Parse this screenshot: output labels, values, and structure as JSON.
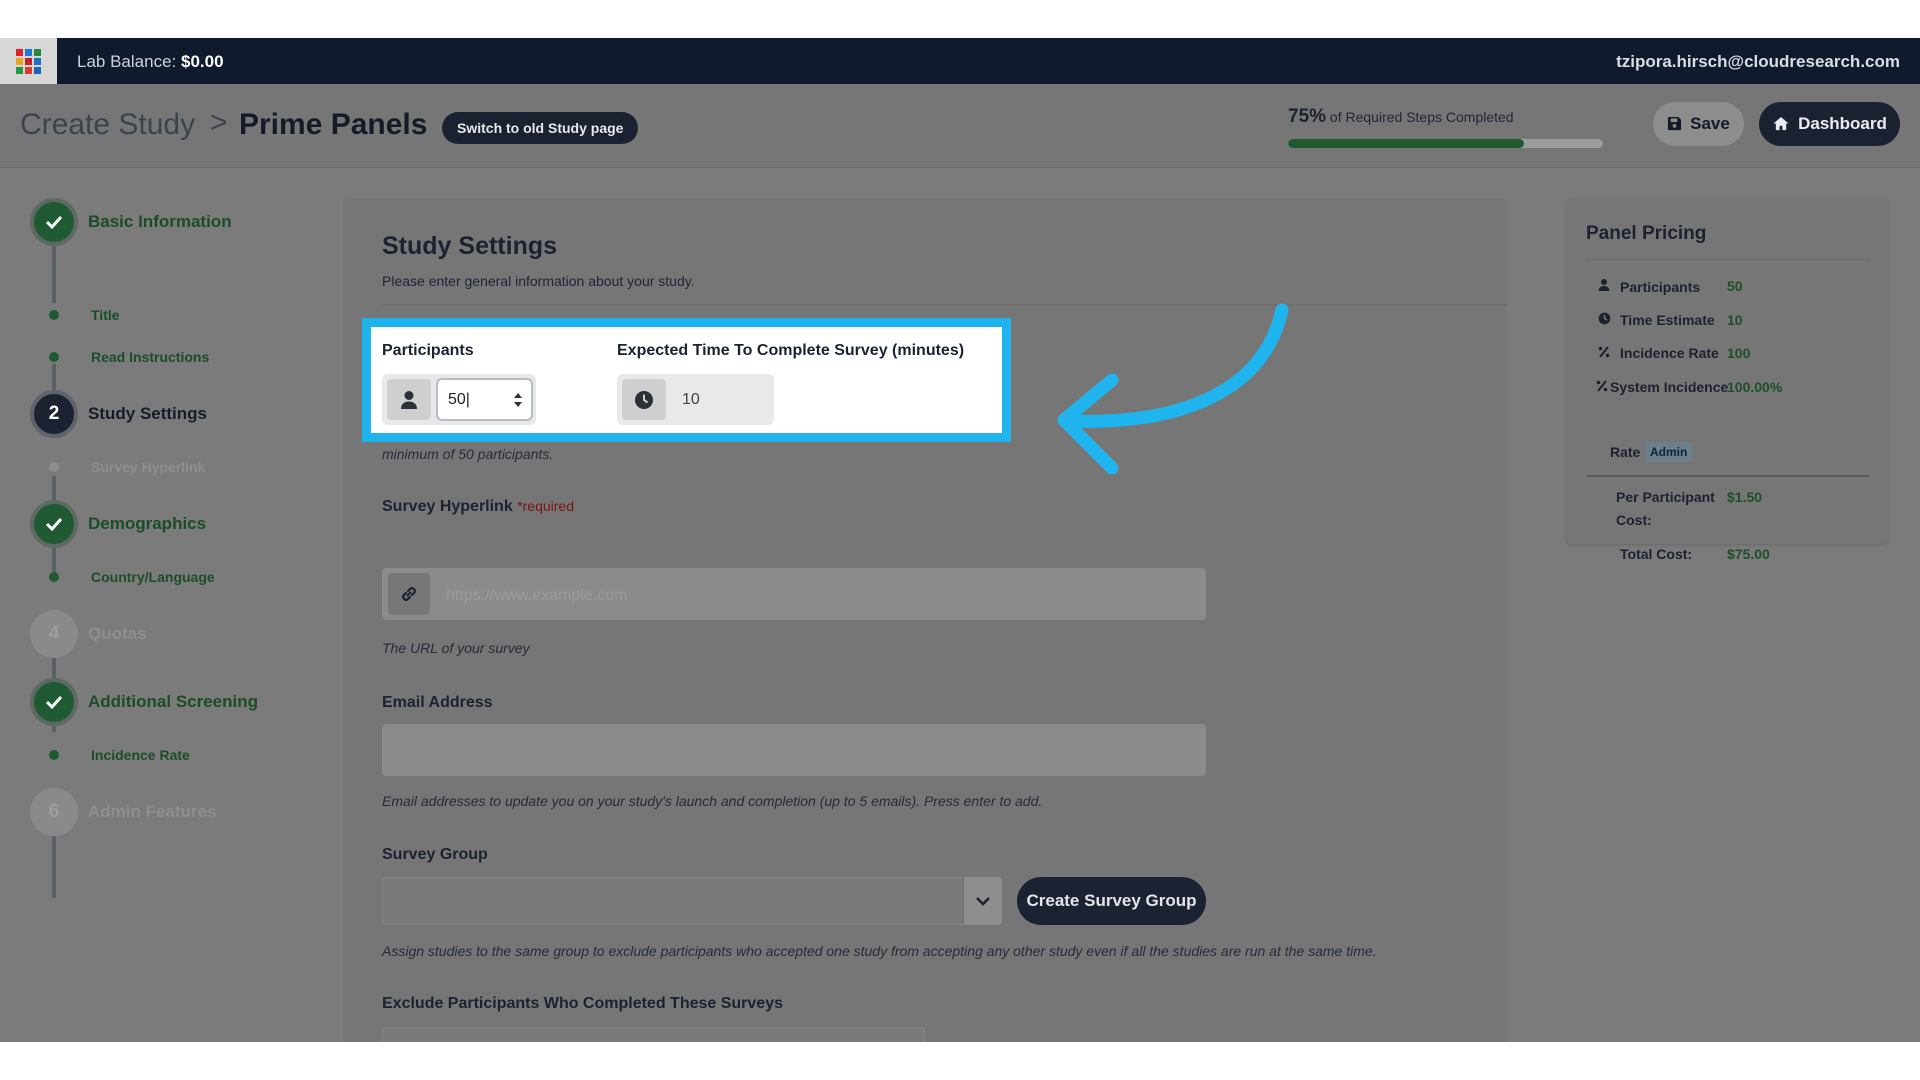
{
  "topbar": {
    "lab_balance_label": "Lab Balance:",
    "lab_balance_value": "$0.00",
    "user_email": "tzipora.hirsch@cloudresearch.com",
    "apps_colors": [
      "#e0202a",
      "#1f7bd6",
      "#2a8a3a",
      "#e8a320",
      "#c02428",
      "#1b6fc4",
      "#239a3f",
      "#d83a2c",
      "#1e64b6"
    ]
  },
  "header": {
    "crumb_parent": "Create Study",
    "crumb_separator": ">",
    "crumb_current": "Prime Panels",
    "switch_label": "Switch to old Study page",
    "progress_percent": "75%",
    "progress_text": "of Required Steps Completed",
    "progress_fraction": 0.75,
    "save_label": "Save",
    "dashboard_label": "Dashboard"
  },
  "sidebar": {
    "steps": [
      {
        "label": "Basic Information",
        "marker": "",
        "state": "done"
      },
      {
        "label": "Study Settings",
        "marker": "2",
        "state": "active"
      },
      {
        "label": "Demographics",
        "marker": "",
        "state": "done"
      },
      {
        "label": "Quotas",
        "marker": "4",
        "state": "todo"
      },
      {
        "label": "Additional Screening",
        "marker": "",
        "state": "done"
      },
      {
        "label": "Admin Features",
        "marker": "6",
        "state": "todo"
      }
    ],
    "substeps": [
      {
        "label": "Title",
        "state": "done"
      },
      {
        "label": "Read Instructions",
        "state": "done"
      },
      {
        "label": "Survey Hyperlink",
        "state": "todo"
      },
      {
        "label": "Country/Language",
        "state": "done"
      },
      {
        "label": "Incidence Rate",
        "state": "done"
      }
    ]
  },
  "main": {
    "title": "Study Settings",
    "description": "Please enter general information about your study.",
    "participants_label": "Participants",
    "participants_value": "50",
    "time_label": "Expected Time To Complete Survey (minutes)",
    "time_value": "10",
    "min_note": "minimum of 50 participants.",
    "hyperlink_label": "Survey Hyperlink",
    "hyperlink_required": "*required",
    "hyperlink_placeholder": "https://www.example.com",
    "hyperlink_help": "The URL of your survey",
    "email_label": "Email Address",
    "email_help": "Email addresses to update you on your study's launch and completion (up to 5 emails). Press enter to add.",
    "group_label": "Survey Group",
    "create_group_label": "Create Survey Group",
    "group_help": "Assign studies to the same group to exclude participants who accepted one study from accepting any other study even if all the studies are run at the same time.",
    "exclude_label": "Exclude Participants Who Completed These Surveys",
    "exclude_clear": "×"
  },
  "pricing": {
    "title": "Panel Pricing",
    "participants_label": "Participants",
    "participants_value": "50",
    "time_label": "Time Estimate",
    "time_value": "10",
    "incidence_label": "Incidence Rate",
    "incidence_value": "100",
    "system_label_1": "System Incidence",
    "system_label_2": "Rate",
    "system_value": "100.00%",
    "admin_badge": "Admin",
    "per_participant_label_1": "Per Participant",
    "per_participant_label_2": "Cost:",
    "per_participant_value": "$1.50",
    "total_label": "Total Cost:",
    "total_value": "$75.00"
  },
  "colors": {
    "accent_highlight": "#1fb4ee",
    "success_green": "#1f5a32",
    "navy": "#1b2232"
  }
}
